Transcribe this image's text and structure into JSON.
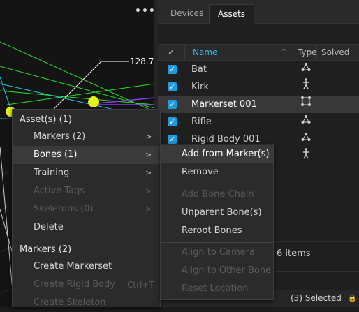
{
  "viewport": {
    "menu_dots": "•••",
    "measurement": "128.7"
  },
  "panel": {
    "tabs": [
      {
        "label": "Devices",
        "active": false
      },
      {
        "label": "Assets",
        "active": true
      }
    ],
    "columns": {
      "check": "✓",
      "name": "Name",
      "sort_icon": "chevron-up-icon",
      "type": "Type",
      "solved": "Solved"
    },
    "rows": [
      {
        "name": "Bat",
        "type_icon": "rigid-body-icon",
        "checked": true,
        "selected": false
      },
      {
        "name": "Kirk",
        "type_icon": "skeleton-icon",
        "checked": true,
        "selected": false
      },
      {
        "name": "Markerset 001",
        "type_icon": "markerset-icon",
        "checked": true,
        "selected": true
      },
      {
        "name": "Rifle",
        "type_icon": "rigid-body-icon",
        "checked": true,
        "selected": false
      },
      {
        "name": "Rigid Body 001",
        "type_icon": "rigid-body-icon",
        "checked": true,
        "selected": false
      },
      {
        "name": "",
        "type_icon": "skeleton-icon",
        "checked": false,
        "selected": false
      }
    ],
    "item_count": "6 items",
    "selection_status": "(3) Selected"
  },
  "context_menu": {
    "assets_header": "Asset(s) (1)",
    "items": [
      {
        "label": "Markers (2)",
        "submenu": true,
        "disabled": false
      },
      {
        "label": "Bones (1)",
        "submenu": true,
        "disabled": false,
        "highlighted": true
      },
      {
        "label": "Training",
        "submenu": true,
        "disabled": false
      },
      {
        "label": "Active Tags",
        "submenu": true,
        "disabled": true
      },
      {
        "label": "Skeletons (0)",
        "submenu": true,
        "disabled": true
      },
      {
        "label": "Delete",
        "submenu": false,
        "disabled": false
      }
    ],
    "markers_header": "Markers (2)",
    "marker_items": [
      {
        "label": "Create Markerset",
        "disabled": false
      },
      {
        "label": "Create Rigid Body",
        "disabled": true,
        "shortcut": "Ctrl+T"
      },
      {
        "label": "Create Skeleton",
        "disabled": true
      }
    ]
  },
  "bones_submenu": {
    "items": [
      {
        "label": "Add from Marker(s)",
        "disabled": false,
        "highlighted": true
      },
      {
        "label": "Remove",
        "disabled": false
      },
      {
        "label": "Add Bone Chain",
        "disabled": true
      },
      {
        "label": "Unparent Bone(s)",
        "disabled": false
      },
      {
        "label": "Reroot Bones",
        "disabled": false
      },
      {
        "label": "Align to Camera",
        "disabled": true
      },
      {
        "label": "Align to Other Bone",
        "disabled": true
      },
      {
        "label": "Reset Location",
        "disabled": true
      }
    ]
  },
  "colors": {
    "accent": "#1e9be0",
    "name_header": "#34b7e8",
    "marker": "#e5f21a"
  }
}
